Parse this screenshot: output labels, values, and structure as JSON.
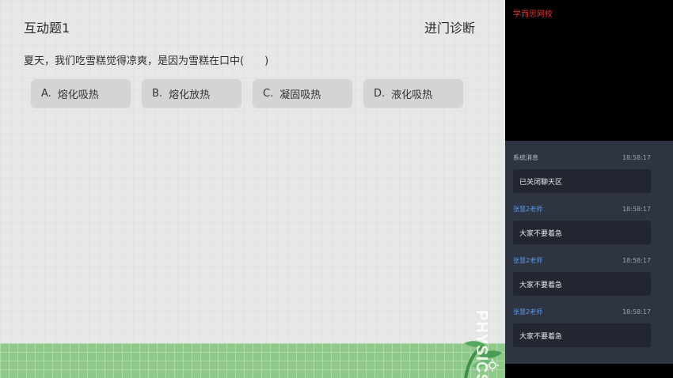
{
  "board": {
    "title": "互动题1",
    "heading": "进门诊断",
    "question": "夏天，我们吃雪糕觉得凉爽，是因为雪糕在口中(　　)",
    "options": [
      {
        "letter": "A.",
        "text": "熔化吸热"
      },
      {
        "letter": "B.",
        "text": "熔化放热"
      },
      {
        "letter": "C.",
        "text": "凝固吸热"
      },
      {
        "letter": "D.",
        "text": "液化吸热"
      }
    ],
    "decor_text": "PHYSICS"
  },
  "video": {
    "brand": "学而思网校"
  },
  "chat": {
    "messages": [
      {
        "sender": "系统消息",
        "time": "18:58:17",
        "text": "已关闭聊天区",
        "role": "system"
      },
      {
        "sender": "张慧2老师",
        "time": "18:58:17",
        "text": "大家不要着急",
        "role": "teacher"
      },
      {
        "sender": "张慧2老师",
        "time": "18:58:17",
        "text": "大家不要着急",
        "role": "teacher"
      },
      {
        "sender": "张慧2老师",
        "time": "18:58:17",
        "text": "大家不要着急",
        "role": "teacher"
      }
    ]
  },
  "colors": {
    "board_bg": "#e6e8e6",
    "option_bg": "#d3d5d3",
    "grass": "#8fc98a",
    "chat_bg": "#2e3441",
    "bubble_bg": "#212630",
    "teacher_name": "#5d9be8",
    "brand_red": "#e0332d"
  }
}
